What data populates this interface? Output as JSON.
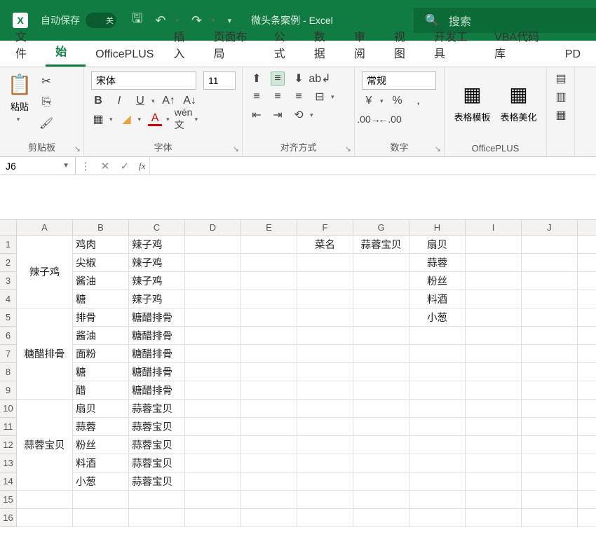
{
  "titlebar": {
    "autosave_label": "自动保存",
    "autosave_state": "关",
    "doc_title": "微头条案例 - Excel",
    "search_placeholder": "搜索"
  },
  "tabs": [
    "文件",
    "开始",
    "OfficePLUS",
    "插入",
    "页面布局",
    "公式",
    "数据",
    "审阅",
    "视图",
    "开发工具",
    "VBA代码库",
    "PD"
  ],
  "active_tab": "开始",
  "ribbon": {
    "clipboard": {
      "label": "剪贴板",
      "paste": "粘贴"
    },
    "font": {
      "label": "字体",
      "name": "宋体",
      "size": "11"
    },
    "align": {
      "label": "对齐方式"
    },
    "number": {
      "label": "数字",
      "format": "常规"
    },
    "officeplus": {
      "label": "OfficePLUS",
      "template": "表格模板",
      "beautify": "表格美化"
    }
  },
  "namebox": "J6",
  "columns": [
    "A",
    "B",
    "C",
    "D",
    "E",
    "F",
    "G",
    "H",
    "I",
    "J"
  ],
  "rows": 16,
  "cells": {
    "A1": {
      "v": "辣子鸡",
      "rs": 4,
      "center": true
    },
    "B1": {
      "v": "鸡肉"
    },
    "C1": {
      "v": "辣子鸡"
    },
    "B2": {
      "v": "尖椒"
    },
    "C2": {
      "v": "辣子鸡"
    },
    "B3": {
      "v": "酱油"
    },
    "C3": {
      "v": "辣子鸡"
    },
    "B4": {
      "v": "糖"
    },
    "C4": {
      "v": "辣子鸡"
    },
    "A5": {
      "v": "糖醋排骨",
      "rs": 5,
      "center": true
    },
    "B5": {
      "v": "排骨"
    },
    "C5": {
      "v": "糖醋排骨"
    },
    "B6": {
      "v": "酱油"
    },
    "C6": {
      "v": "糖醋排骨"
    },
    "B7": {
      "v": "面粉"
    },
    "C7": {
      "v": "糖醋排骨"
    },
    "B8": {
      "v": "糖"
    },
    "C8": {
      "v": "糖醋排骨"
    },
    "B9": {
      "v": "醋"
    },
    "C9": {
      "v": "糖醋排骨"
    },
    "A10": {
      "v": "蒜蓉宝贝",
      "rs": 5,
      "center": true
    },
    "B10": {
      "v": "扇贝"
    },
    "C10": {
      "v": "蒜蓉宝贝"
    },
    "B11": {
      "v": "蒜蓉"
    },
    "C11": {
      "v": "蒜蓉宝贝"
    },
    "B12": {
      "v": "粉丝"
    },
    "C12": {
      "v": "蒜蓉宝贝"
    },
    "B13": {
      "v": "料酒"
    },
    "C13": {
      "v": "蒜蓉宝贝"
    },
    "B14": {
      "v": "小葱"
    },
    "C14": {
      "v": "蒜蓉宝贝"
    },
    "F1": {
      "v": "菜名",
      "center": true
    },
    "G1": {
      "v": "蒜蓉宝贝",
      "center": true
    },
    "H1": {
      "v": "扇贝",
      "center": true
    },
    "H2": {
      "v": "蒜蓉",
      "center": true
    },
    "H3": {
      "v": "粉丝",
      "center": true
    },
    "H4": {
      "v": "料酒",
      "center": true
    },
    "H5": {
      "v": "小葱",
      "center": true
    }
  }
}
